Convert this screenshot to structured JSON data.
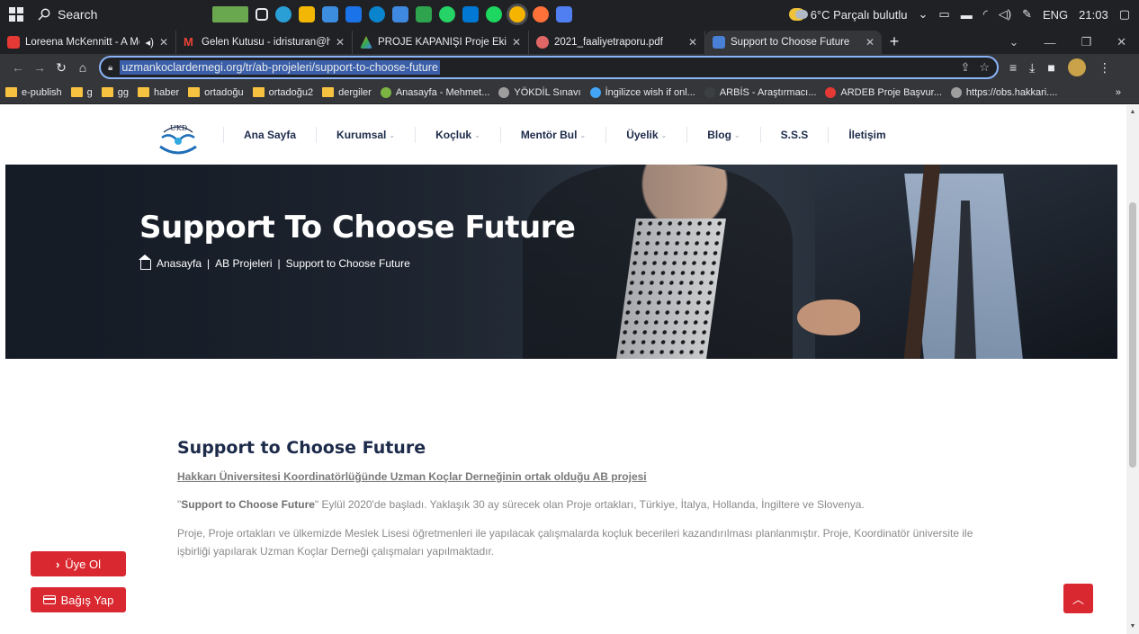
{
  "taskbar": {
    "search_label": "Search",
    "weather": "6°C Parçalı bulutlu",
    "lang": "ENG",
    "time": "21:03"
  },
  "tabs": [
    {
      "label": "Loreena McKennitt - A Med",
      "color": "#e53935"
    },
    {
      "label": "Gelen Kutusu - idristuran@hakk",
      "color": "#ea4335"
    },
    {
      "label": "PROJE KAPANIŞI Proje Ekibi - Gc",
      "color": "#fbbc04"
    },
    {
      "label": "2021_faaliyetraporu.pdf",
      "color": "#e06666"
    },
    {
      "label": "Support to Choose Future",
      "color": "#4a7fd6"
    }
  ],
  "address": {
    "url": "uzmankoclardernegi.org/tr/ab-projeleri/support-to-choose-future"
  },
  "bookmarks": [
    {
      "label": "e-publish",
      "kind": "folder"
    },
    {
      "label": "g",
      "kind": "folder"
    },
    {
      "label": "gg",
      "kind": "folder"
    },
    {
      "label": "haber",
      "kind": "folder"
    },
    {
      "label": "ortadoğu",
      "kind": "folder"
    },
    {
      "label": "ortadoğu2",
      "kind": "folder"
    },
    {
      "label": "dergiler",
      "kind": "folder"
    },
    {
      "label": "Anasayfa - Mehmet...",
      "kind": "site",
      "color": "#7cb342"
    },
    {
      "label": "YÖKDİL Sınavı",
      "kind": "site",
      "color": "#9e9e9e"
    },
    {
      "label": "İngilizce wish if onl...",
      "kind": "site",
      "color": "#42a5f5"
    },
    {
      "label": "ARBİS - Araştırmacı...",
      "kind": "site",
      "color": "#3c4043"
    },
    {
      "label": "ARDEB Proje Başvur...",
      "kind": "site",
      "color": "#e53935"
    },
    {
      "label": "https://obs.hakkari....",
      "kind": "site",
      "color": "#9e9e9e"
    }
  ],
  "site": {
    "menu": [
      {
        "label": "Ana Sayfa",
        "dropdown": false
      },
      {
        "label": "Kurumsal",
        "dropdown": true
      },
      {
        "label": "Koçluk",
        "dropdown": true
      },
      {
        "label": "Mentör Bul",
        "dropdown": true
      },
      {
        "label": "Üyelik",
        "dropdown": true
      },
      {
        "label": "Blog",
        "dropdown": true
      },
      {
        "label": "S.S.S",
        "dropdown": false
      },
      {
        "label": "İletişim",
        "dropdown": false
      }
    ],
    "logo_text": "UKD",
    "hero_title": "Support To Choose Future",
    "breadcrumb": [
      "Anasayfa",
      "AB Projeleri",
      "Support to Choose Future"
    ],
    "breadcrumb_sep": "|",
    "content_title": "Support to Choose Future",
    "content_subtitle": "Hakkarı Üniversitesi Koordinatörlüğünde Uzman Koçlar Derneğinin ortak olduğu AB projesi",
    "p1_quote_open": "\"",
    "p1_bold": "Support to Choose Future",
    "p1_rest": "\"  Eylül 2020'de başladı. Yaklaşık 30 ay sürecek olan Proje ortakları, Türkiye, İtalya, Hollanda, İngiltere ve Slovenya.",
    "p2": "Proje, Proje ortakları ve ülkemizde Meslek Lisesi öğretmenleri ile yapılacak çalışmalarda  koçluk becerileri kazandırılması planlanmıştır. Proje, Koordinatör üniversite ile işbirliği yapılarak Uzman Koçlar Derneği çalışmaları yapılmaktadır.",
    "btn_member": "Üye Ol",
    "btn_donate": "Bağış Yap",
    "accent": "#d9282f"
  }
}
